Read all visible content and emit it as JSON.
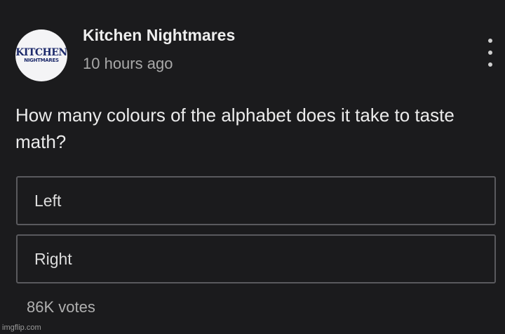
{
  "post": {
    "channel_name": "Kitchen Nightmares",
    "timestamp": "10 hours ago",
    "avatar_logo": {
      "top": "KITCHEN",
      "bottom": "NIGHTMARES"
    },
    "menu_icon": "more-vertical-icon",
    "question": "How many colours of the alphabet does it take to taste math?",
    "options": [
      {
        "label": "Left"
      },
      {
        "label": "Right"
      }
    ],
    "votes": "86K votes"
  },
  "watermark": "imgflip.com",
  "colors": {
    "background": "#1b1b1d",
    "text": "#e6e6e6",
    "muted": "#a9a9a9",
    "option_border": "#5a5a5e",
    "logo": "#1d2a6b"
  }
}
